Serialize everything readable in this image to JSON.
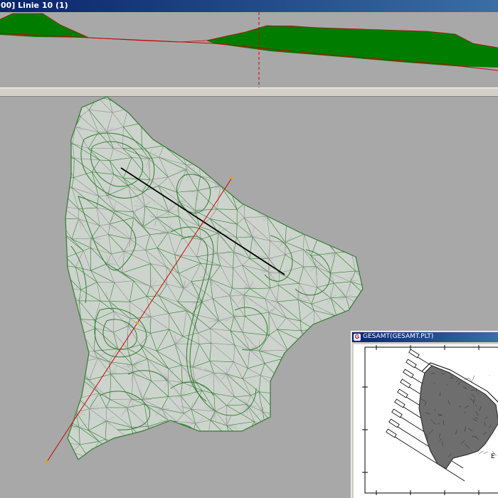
{
  "window": {
    "title": "00] Linie 10 (1)"
  },
  "overview_window": {
    "title": "GESAMT(GESAMT.PLT)",
    "icon": "app-icon"
  },
  "colors": {
    "terrain_fill": "#007c00",
    "profile_line": "#cc0000",
    "mesh_green": "#2f7d2f",
    "mesh_grey": "#808080",
    "surface_fill": "#cdd4cd",
    "cross_section": "#000000",
    "background": "#a8a8a8"
  }
}
